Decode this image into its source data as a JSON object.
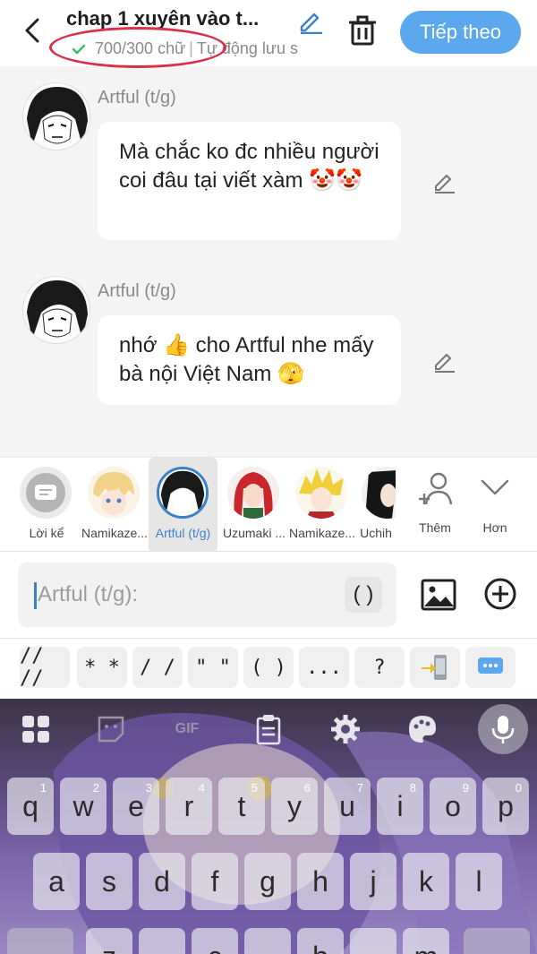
{
  "header": {
    "title": "chap 1 xuyên vào t...",
    "word_count": "700/300 chữ",
    "separator": "|",
    "autosave": "Tự động lưu s",
    "next_label": "Tiếp theo"
  },
  "messages": [
    {
      "author": "Artful (t/g)",
      "text": "Mà chắc ko đc nhiều người coi đâu tại viết xàm 🤡🤡"
    },
    {
      "author": "Artful (t/g)",
      "text": "nhớ 👍 cho Artful nhe mấy bà nội Việt Nam 🫣"
    }
  ],
  "characters": [
    {
      "name": "Lời kể"
    },
    {
      "name": "Namikaze..."
    },
    {
      "name": "Artful (t/g)"
    },
    {
      "name": "Uzumaki ..."
    },
    {
      "name": "Namikaze..."
    },
    {
      "name": "Uchih"
    }
  ],
  "picker_actions": {
    "add_label": "Thêm",
    "more_label": "Hơn"
  },
  "input": {
    "placeholder": "Artful (t/g):",
    "paren_label": "( )"
  },
  "chips": [
    "// //",
    "* *",
    "/ /",
    "\" \"",
    "( )",
    "...",
    "?"
  ],
  "keyboard": {
    "row1": [
      {
        "key": "q",
        "hint": "1"
      },
      {
        "key": "w",
        "hint": "2"
      },
      {
        "key": "e",
        "hint": "3"
      },
      {
        "key": "r",
        "hint": "4"
      },
      {
        "key": "t",
        "hint": "5"
      },
      {
        "key": "y",
        "hint": "6"
      },
      {
        "key": "u",
        "hint": "7"
      },
      {
        "key": "i",
        "hint": "8"
      },
      {
        "key": "o",
        "hint": "9"
      },
      {
        "key": "p",
        "hint": "0"
      }
    ],
    "row2": [
      "a",
      "s",
      "d",
      "f",
      "g",
      "h",
      "j",
      "k",
      "l"
    ],
    "row3_partial": [
      "z",
      "c",
      "b",
      "m"
    ],
    "gif_label": "GIF"
  },
  "colors": {
    "accent": "#5ca8ef",
    "highlight": "#d9314a",
    "selected": "#3b82c4"
  }
}
